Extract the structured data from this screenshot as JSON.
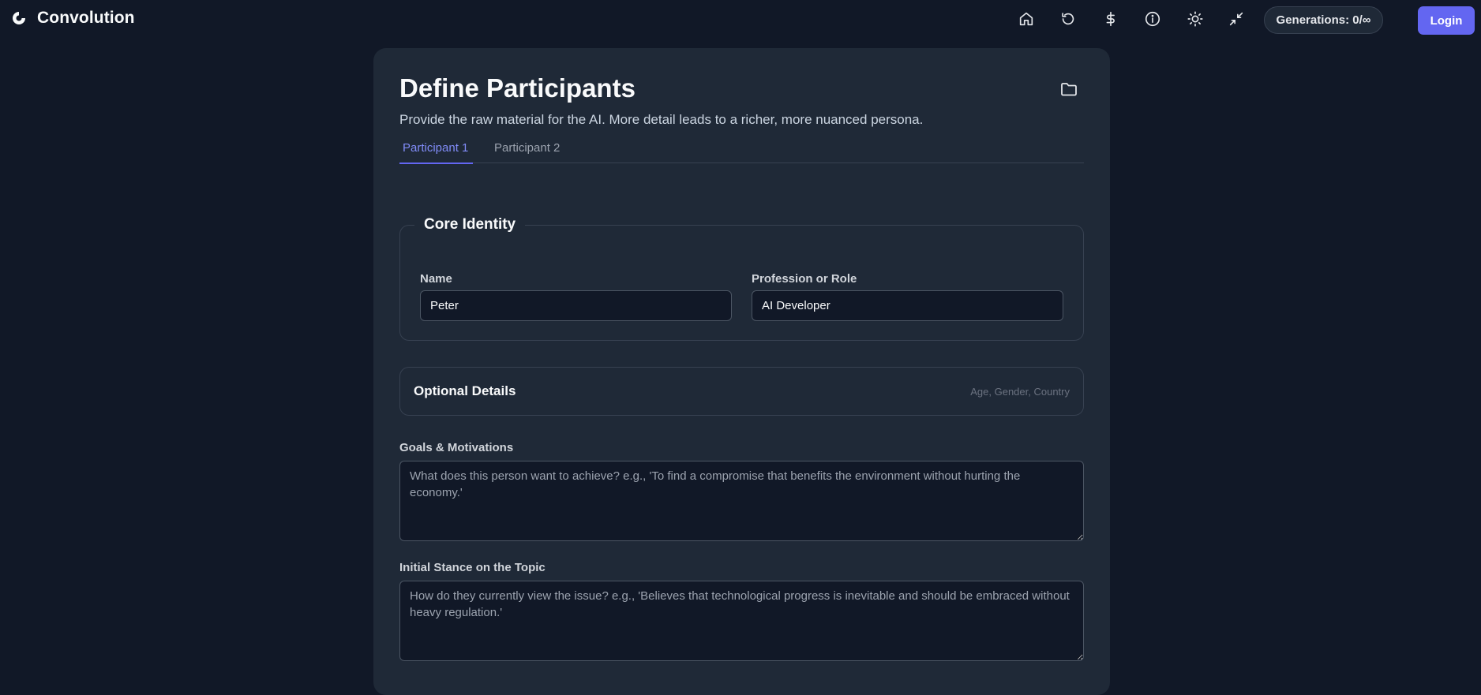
{
  "app": {
    "name": "Convolution"
  },
  "nav": {
    "icons": [
      "home-icon",
      "history-icon",
      "dollar-icon",
      "info-icon",
      "sun-icon",
      "minimize-icon"
    ],
    "generations_label": "Generations: 0/∞",
    "login_label": "Login"
  },
  "page": {
    "title": "Define Participants",
    "subtitle": "Provide the raw material for the AI. More detail leads to a richer, more nuanced persona."
  },
  "tabs": [
    {
      "label": "Participant 1",
      "active": true
    },
    {
      "label": "Participant 2",
      "active": false
    }
  ],
  "core_identity": {
    "legend": "Core Identity",
    "name_label": "Name",
    "name_value": "Peter",
    "role_label": "Profession or Role",
    "role_value": "AI Developer"
  },
  "optional_details": {
    "title": "Optional Details",
    "hint": "Age, Gender, Country"
  },
  "goals": {
    "label": "Goals & Motivations",
    "placeholder": "What does this person want to achieve? e.g., 'To find a compromise that benefits the environment without hurting the economy.'"
  },
  "stance": {
    "label": "Initial Stance on the Topic",
    "placeholder": "How do they currently view the issue? e.g., 'Believes that technological progress is inevitable and should be embraced without heavy regulation.'"
  },
  "colors": {
    "background": "#111827",
    "card": "#1f2937",
    "accent": "#6366f1",
    "accent_text": "#818cf8"
  }
}
